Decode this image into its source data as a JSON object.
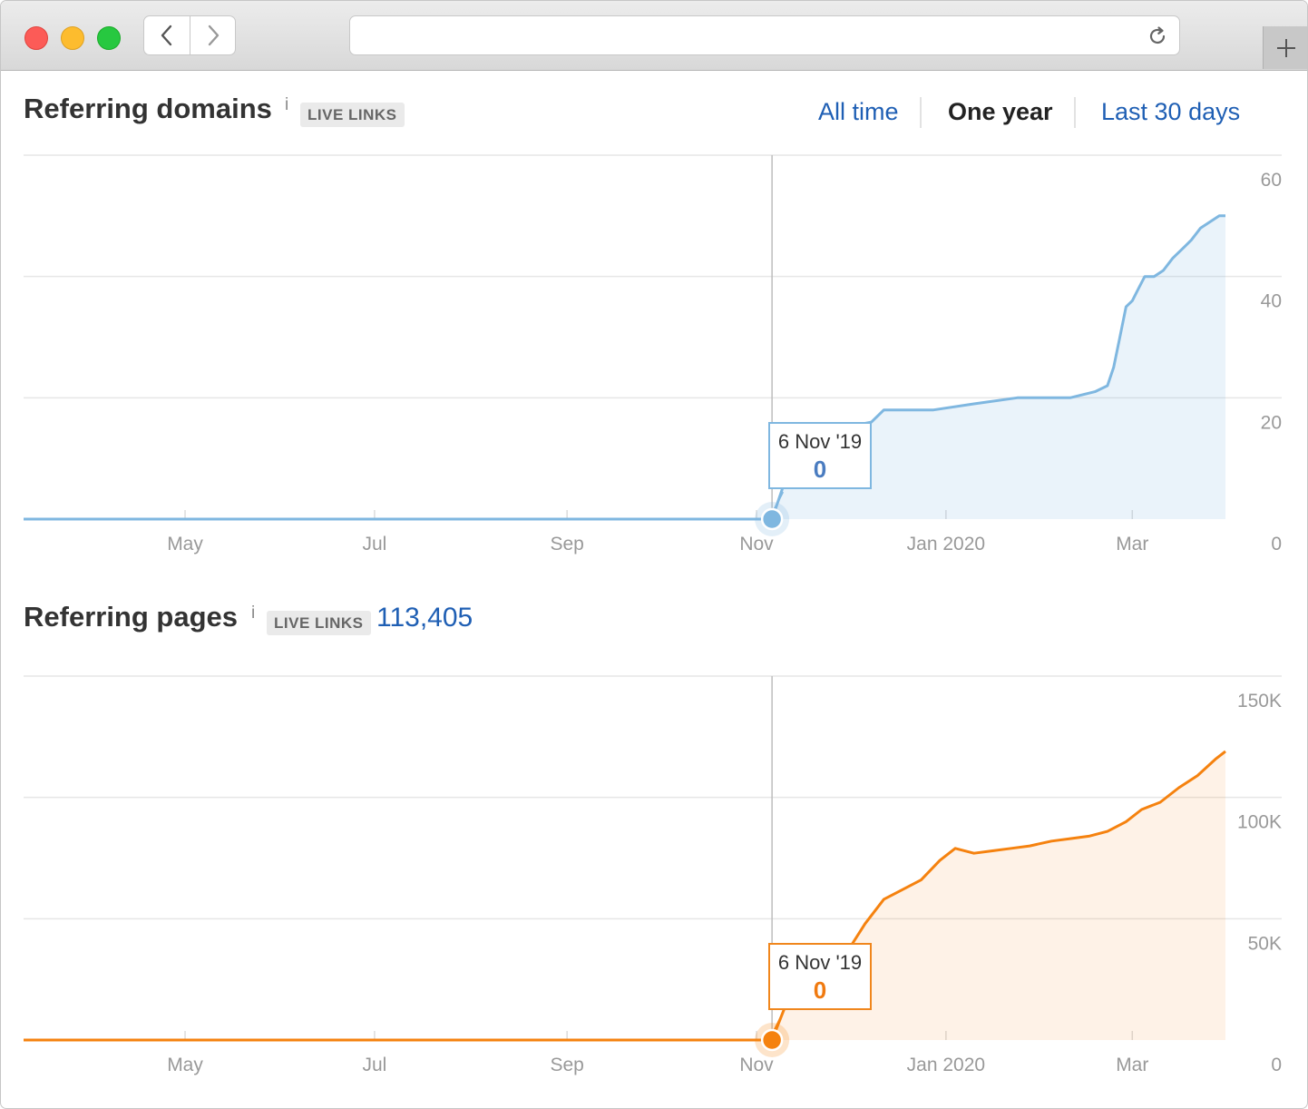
{
  "browser": {
    "url": "",
    "icons": {
      "back": "chevron-left-icon",
      "forward": "chevron-right-icon",
      "reload": "reload-icon",
      "new_tab": "plus-icon"
    }
  },
  "domains": {
    "title": "Referring domains",
    "info": "i",
    "badge": "LIVE LINKS",
    "ranges": [
      "All time",
      "One year",
      "Last 30 days"
    ],
    "active_range": "One year",
    "tooltip": {
      "date": "6 Nov '19",
      "value": "0"
    },
    "color": "#7fb7e0"
  },
  "pages": {
    "title": "Referring pages",
    "info": "i",
    "badge": "LIVE LINKS",
    "total": "113,405",
    "tooltip": {
      "date": "6 Nov '19",
      "value": "0"
    },
    "color": "#f5820f"
  },
  "chart_data": [
    {
      "type": "area",
      "name": "Referring domains",
      "x_tick_labels": [
        "May",
        "Jul",
        "Sep",
        "Nov",
        "Jan 2020",
        "Mar"
      ],
      "y_tick_labels": [
        "0",
        "20",
        "40",
        "60"
      ],
      "ylim": [
        0,
        60
      ],
      "grid": true,
      "x": [
        "2019-03-10",
        "2019-05-01",
        "2019-07-01",
        "2019-09-01",
        "2019-11-06",
        "2019-11-10",
        "2019-11-14",
        "2019-11-20",
        "2019-11-28",
        "2019-12-08",
        "2019-12-12",
        "2019-12-28",
        "2020-01-10",
        "2020-01-24",
        "2020-02-10",
        "2020-02-18",
        "2020-02-22",
        "2020-02-24",
        "2020-02-26",
        "2020-02-28",
        "2020-03-01",
        "2020-03-03",
        "2020-03-05",
        "2020-03-08",
        "2020-03-11",
        "2020-03-14",
        "2020-03-18",
        "2020-03-20",
        "2020-03-23",
        "2020-03-26",
        "2020-03-29",
        "2020-03-31"
      ],
      "values": [
        0,
        0,
        0,
        0,
        0,
        6,
        12,
        13,
        15,
        16,
        18,
        18,
        19,
        20,
        20,
        21,
        22,
        25,
        30,
        35,
        36,
        38,
        40,
        40,
        41,
        43,
        45,
        46,
        48,
        49,
        50,
        50
      ]
    },
    {
      "type": "area",
      "name": "Referring pages",
      "x_tick_labels": [
        "May",
        "Jul",
        "Sep",
        "Nov",
        "Jan 2020",
        "Mar"
      ],
      "y_tick_labels": [
        "0",
        "50K",
        "100K",
        "150K"
      ],
      "ylim": [
        0,
        150000
      ],
      "grid": true,
      "x": [
        "2019-03-10",
        "2019-05-01",
        "2019-07-01",
        "2019-09-01",
        "2019-11-06",
        "2019-11-10",
        "2019-11-14",
        "2019-11-20",
        "2019-11-28",
        "2019-12-06",
        "2019-12-12",
        "2019-12-18",
        "2019-12-24",
        "2019-12-30",
        "2020-01-04",
        "2020-01-10",
        "2020-01-16",
        "2020-01-22",
        "2020-01-28",
        "2020-02-04",
        "2020-02-10",
        "2020-02-16",
        "2020-02-22",
        "2020-02-28",
        "2020-03-04",
        "2020-03-10",
        "2020-03-16",
        "2020-03-22",
        "2020-03-28",
        "2020-03-31"
      ],
      "values": [
        0,
        0,
        0,
        0,
        0,
        13000,
        18000,
        23000,
        32000,
        48000,
        58000,
        62000,
        66000,
        74000,
        79000,
        77000,
        78000,
        79000,
        80000,
        82000,
        83000,
        84000,
        86000,
        90000,
        95000,
        98000,
        104000,
        109000,
        116000,
        119000
      ]
    }
  ]
}
